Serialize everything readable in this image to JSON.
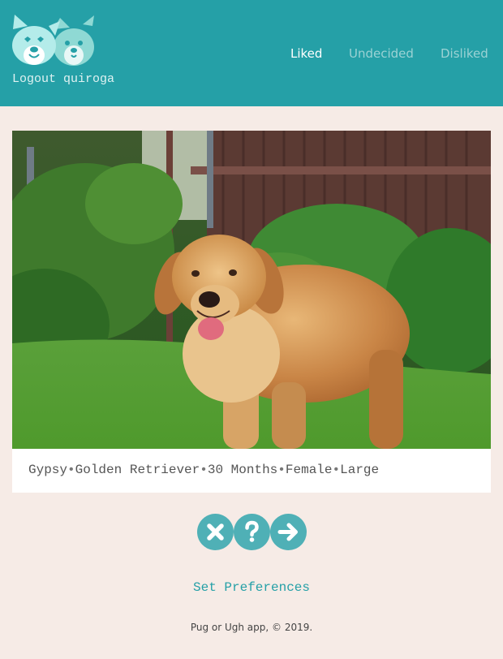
{
  "header": {
    "logout_label": "Logout quiroga",
    "nav": [
      {
        "label": "Liked",
        "active": true
      },
      {
        "label": "Undecided",
        "active": false
      },
      {
        "label": "Disliked",
        "active": false
      }
    ]
  },
  "dog": {
    "name": "Gypsy",
    "breed": "Golden Retriever",
    "age": "30 Months",
    "sex": "Female",
    "size": "Large",
    "separator": "•"
  },
  "actions": {
    "dislike_icon": "x-icon",
    "undecided_icon": "question-icon",
    "like_icon": "arrow-right-icon"
  },
  "preferences_label": "Set Preferences",
  "footer_text": "Pug or Ugh app, © 2019.",
  "colors": {
    "header_bg": "#25a0a7",
    "page_bg": "#f6ebe6",
    "button_bg": "#4fb0b6",
    "link": "#25a0a7"
  }
}
